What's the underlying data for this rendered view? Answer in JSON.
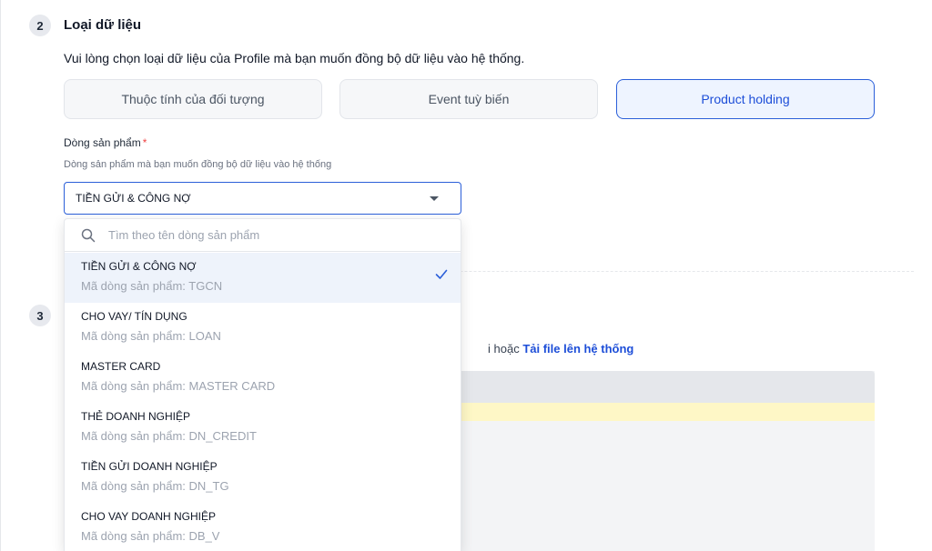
{
  "step2": {
    "number": "2",
    "title": "Loại dữ liệu",
    "description": "Vui lòng chọn loại dữ liệu của Profile mà bạn muốn đồng bộ dữ liệu vào hệ thống.",
    "types": [
      {
        "label": "Thuộc tính của đối tượng",
        "selected": false
      },
      {
        "label": "Event tuỳ biến",
        "selected": false
      },
      {
        "label": "Product holding",
        "selected": true
      }
    ]
  },
  "product_line": {
    "label": "Dòng sản phẩm",
    "required_mark": "*",
    "help": "Dòng sản phẩm mà bạn muốn đồng bộ dữ liệu vào hệ thống",
    "selected_value": "TIỀN GỬI & CÔNG NỢ",
    "search_placeholder": "Tìm theo tên dòng sản phẩm",
    "options": [
      {
        "name": "TIỀN GỬI & CÔNG NỢ",
        "code": "Mã dòng sản phẩm: TGCN",
        "selected": true
      },
      {
        "name": "CHO VAY/ TÍN DỤNG",
        "code": "Mã dòng sản phẩm: LOAN",
        "selected": false
      },
      {
        "name": "MASTER CARD",
        "code": "Mã dòng sản phẩm: MASTER CARD",
        "selected": false
      },
      {
        "name": "THẺ DOANH NGHIỆP",
        "code": "Mã dòng sản phẩm: DN_CREDIT",
        "selected": false
      },
      {
        "name": "TIỀN GỬI DOANH NGHIỆP",
        "code": "Mã dòng sản phẩm: DN_TG",
        "selected": false
      },
      {
        "name": "CHO VAY DOANH NGHIỆP",
        "code": "Mã dòng sản phẩm: DB_V",
        "selected": false
      }
    ]
  },
  "step3": {
    "number": "3",
    "partial_text": "i hoặc ",
    "upload_link": "Tải file lên hệ thống"
  },
  "colors": {
    "accent": "#2b5fd9",
    "selected_bg": "#eef3fb",
    "warning_row": "#fef7c6"
  }
}
